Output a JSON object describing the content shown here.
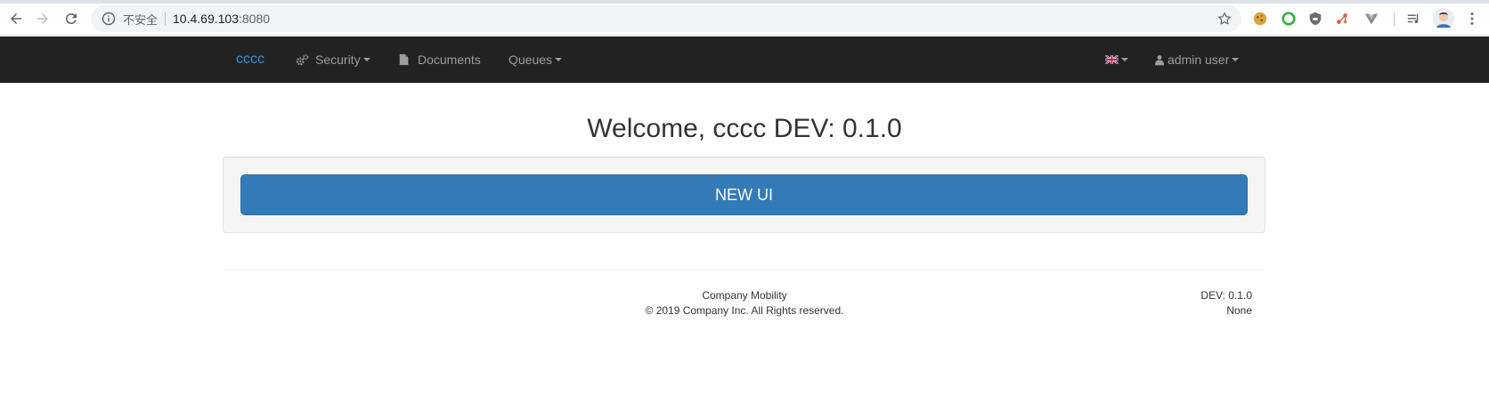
{
  "browser": {
    "security_label": "不安全",
    "url_host": "10.4.69.103",
    "url_port": ":8080"
  },
  "navbar": {
    "brand": "cccc",
    "security": "Security",
    "documents": "Documents",
    "queues": "Queues",
    "user": "admin user"
  },
  "main": {
    "welcome": "Welcome, cccc DEV: 0.1.0",
    "new_ui_button": "NEW UI"
  },
  "footer": {
    "company": "Company Mobility",
    "copyright": "© 2019 Company Inc. All Rights reserved.",
    "version": "DEV: 0.1.0",
    "environment": "None"
  },
  "colors": {
    "navbar_bg": "#222222",
    "brand": "#3a8fd6",
    "primary_button": "#337ab7"
  }
}
